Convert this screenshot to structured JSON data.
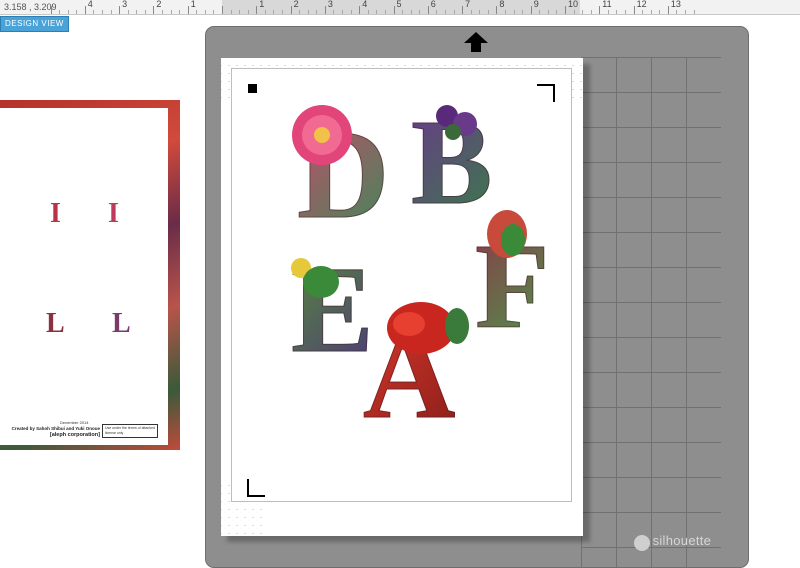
{
  "ruler": {
    "coordinates": "3.158 , 3.209",
    "numbers": [
      "1",
      "2",
      "3",
      "4",
      "5",
      "6",
      "7",
      "8",
      "9",
      "10",
      "11",
      "12",
      "13"
    ],
    "partial_numbers": [
      "5",
      "4",
      "3",
      "2",
      "1"
    ]
  },
  "mode": {
    "design_view": "DESIGN VIEW"
  },
  "preview": {
    "mini_letters": [
      "I",
      "I",
      "L",
      "L"
    ],
    "credit_line1": "Created by Sahoh Shibui and Yuki Onoue",
    "credit_org": "[aleph corporation]",
    "date": "December 2014",
    "box_note": "Use under the terms of attached license only"
  },
  "mat": {
    "brand": "silhouette",
    "load_arrow": "arrow-up-icon",
    "colors": {
      "mat": "#8e8e8e",
      "grid": "#6e6e6e"
    }
  },
  "letters": [
    {
      "char": "D",
      "color_from": "#c84a6a",
      "color_to": "#3c8a5a"
    },
    {
      "char": "B",
      "color_from": "#6a3a8a",
      "color_to": "#3a7a4a"
    },
    {
      "char": "E",
      "color_from": "#5a8a3a",
      "color_to": "#4a3a7a"
    },
    {
      "char": "F",
      "color_from": "#8a3a4a",
      "color_to": "#4a9a4a"
    },
    {
      "char": "A",
      "color_from": "#d8382a",
      "color_to": "#8a1e1a"
    }
  ]
}
